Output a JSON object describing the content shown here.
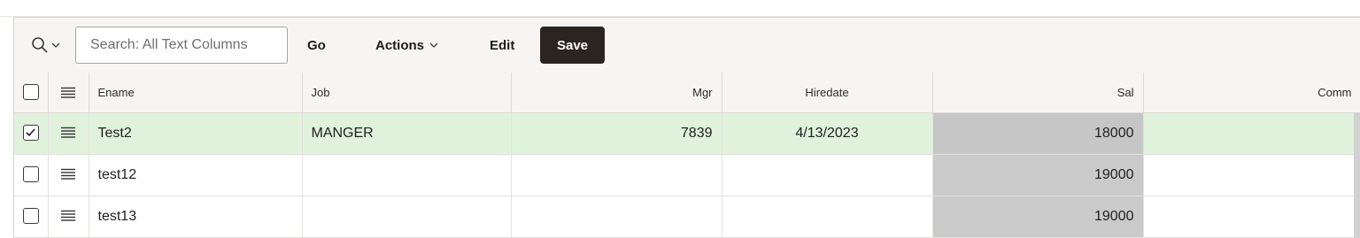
{
  "toolbar": {
    "search_placeholder": "Search: All Text Columns",
    "go_label": "Go",
    "actions_label": "Actions",
    "edit_label": "Edit",
    "save_label": "Save",
    "search_icon": "magnifier-icon",
    "search_menu_icon": "chevron-down-icon",
    "actions_icon": "chevron-down-icon"
  },
  "grid": {
    "columns": {
      "ename": "Ename",
      "job": "Job",
      "mgr": "Mgr",
      "hiredate": "Hiredate",
      "sal": "Sal",
      "comm": "Comm"
    },
    "rows": [
      {
        "selected": true,
        "ename": "Test2",
        "job": "MANGER",
        "mgr": "7839",
        "hiredate": "4/13/2023",
        "sal": "18000",
        "comm": ""
      },
      {
        "selected": false,
        "ename": "test12",
        "job": "",
        "mgr": "",
        "hiredate": "",
        "sal": "19000",
        "comm": ""
      },
      {
        "selected": false,
        "ename": "test13",
        "job": "",
        "mgr": "",
        "hiredate": "",
        "sal": "19000",
        "comm": ""
      }
    ]
  },
  "colors": {
    "toolbar_bg": "#f6f5f3",
    "selected_row_bg": "#e0f2dc",
    "readonly_cell_bg": "#cacaca",
    "save_button_bg": "#2b2522"
  }
}
